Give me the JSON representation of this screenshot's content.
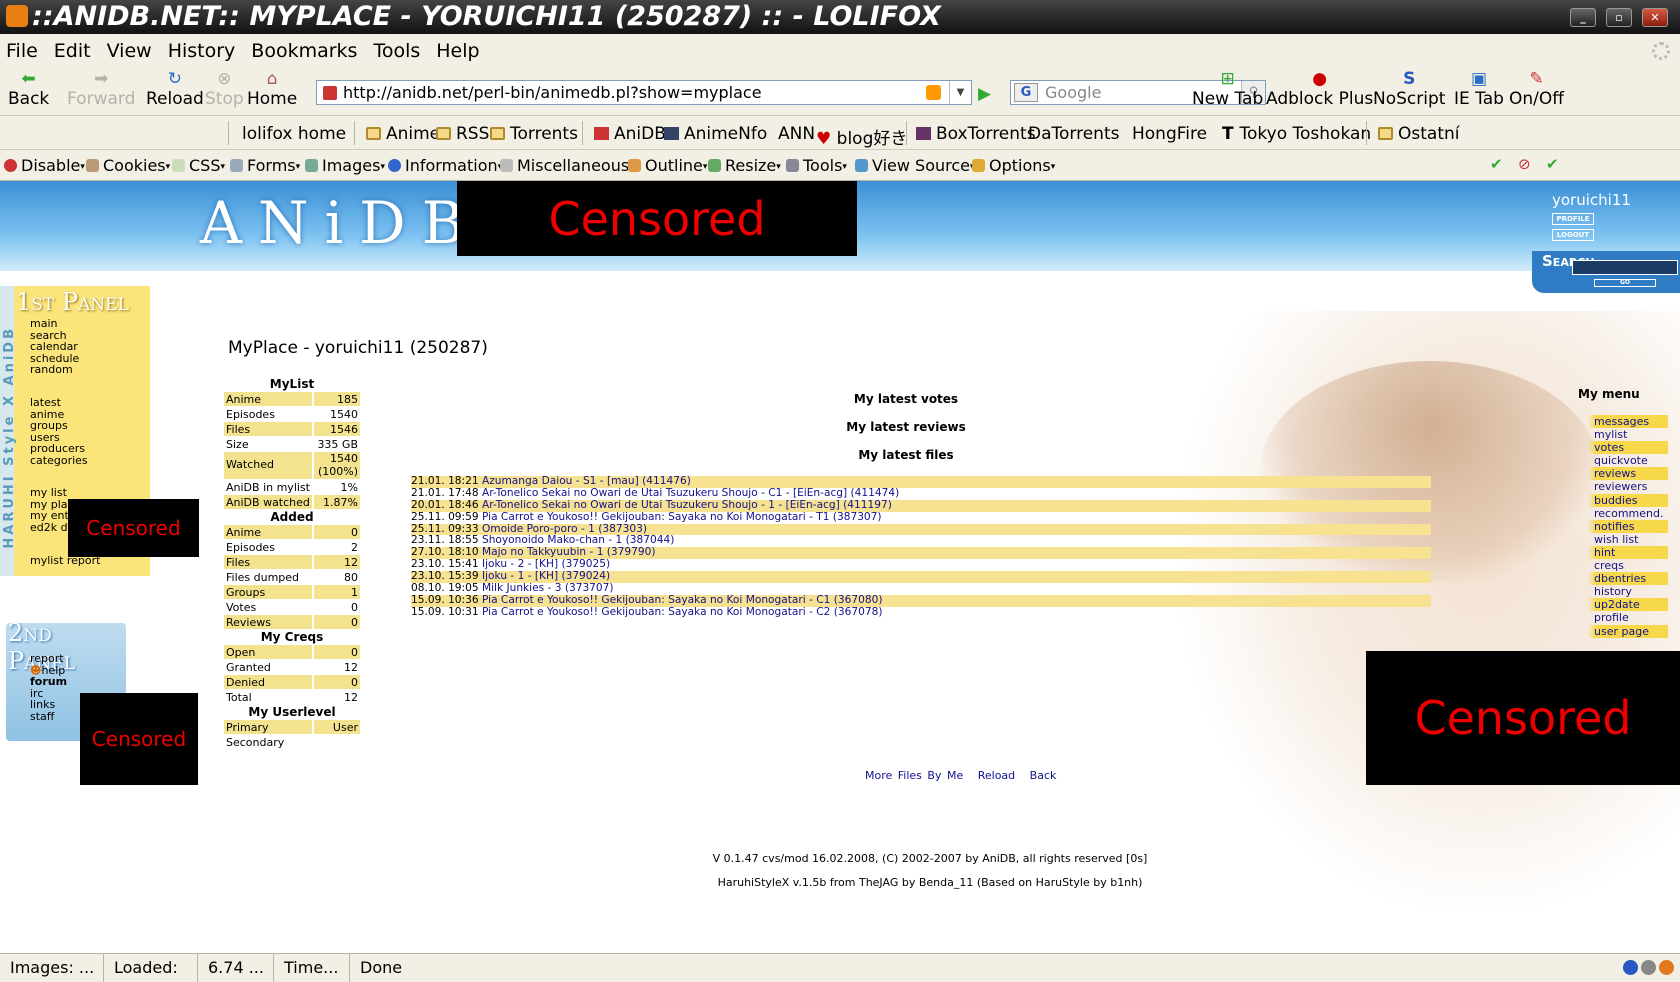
{
  "window": {
    "title": "::ANIDB.NET:: MYPLACE - YORUICHI11 (250287) :: - LOLIFOX"
  },
  "menu": [
    "File",
    "Edit",
    "View",
    "History",
    "Bookmarks",
    "Tools",
    "Help"
  ],
  "nav": {
    "back": "Back",
    "forward": "Forward",
    "reload": "Reload",
    "stop": "Stop",
    "home": "Home",
    "url": "http://anidb.net/perl-bin/animedb.pl?show=myplace",
    "search_placeholder": "Google",
    "new_tab": "New Tab",
    "adblock": "Adblock Plus",
    "noscript": "NoScript",
    "ie_tab": "IE Tab",
    "onoff": "On/Off"
  },
  "bookmarks": [
    "lolifox home",
    "Anime",
    "RSS",
    "Torrents",
    "AniDB",
    "AnimeNfo",
    "ANN",
    "blog好き",
    "BoxTorrents",
    "DaTorrents",
    "HongFire",
    "Tokyo Toshokan",
    "Ostatní"
  ],
  "webdev": [
    "Disable",
    "Cookies",
    "CSS",
    "Forms",
    "Images",
    "Information",
    "Miscellaneous",
    "Outline",
    "Resize",
    "Tools",
    "View Source",
    "Options"
  ],
  "header": {
    "logo": "ANiDB",
    "censored": "Censored",
    "username": "yoruichi11",
    "profile": "PROFILE",
    "logout": "LOGOUT",
    "search_label": "Search",
    "go": "GO"
  },
  "sidebar": {
    "panel1": "1st Panel",
    "vertical": "HARUHI Style X AniDB",
    "group1": [
      "main",
      "search",
      "calendar",
      "schedule",
      "random"
    ],
    "group2": [
      "latest",
      "anime",
      "groups",
      "users",
      "producers",
      "categories"
    ],
    "group3": [
      "my list",
      "my pla",
      "my ent",
      "ed2k d"
    ],
    "mylist_report": "mylist report",
    "panel2": "2nd Panel",
    "group4": [
      "report",
      "help",
      "forum",
      "irc",
      "links",
      "staff"
    ],
    "censored": "Censored"
  },
  "main": {
    "title": "MyPlace - yoruichi11 (250287)",
    "mylist": {
      "heading": "MyList",
      "rows": [
        {
          "k": "Anime",
          "v": "185"
        },
        {
          "k": "Episodes",
          "v": "1540"
        },
        {
          "k": "Files",
          "v": "1546"
        },
        {
          "k": "Size",
          "v": "335 GB"
        },
        {
          "k": "Watched",
          "v": "1540 (100%)"
        },
        {
          "k": "AniDB in mylist",
          "v": "1%"
        },
        {
          "k": "AniDB watched",
          "v": "1.87%"
        }
      ]
    },
    "added": {
      "heading": "Added",
      "rows": [
        {
          "k": "Anime",
          "v": "0"
        },
        {
          "k": "Episodes",
          "v": "2"
        },
        {
          "k": "Files",
          "v": "12"
        },
        {
          "k": "Files dumped",
          "v": "80"
        },
        {
          "k": "Groups",
          "v": "1"
        },
        {
          "k": "Votes",
          "v": "0"
        },
        {
          "k": "Reviews",
          "v": "0"
        }
      ]
    },
    "creqs": {
      "heading": "My Creqs",
      "rows": [
        {
          "k": "Open",
          "v": "0"
        },
        {
          "k": "Granted",
          "v": "12"
        },
        {
          "k": "Denied",
          "v": "0"
        },
        {
          "k": "Total",
          "v": "12"
        }
      ]
    },
    "userlevel": {
      "heading": "My Userlevel",
      "rows": [
        {
          "k": "Primary",
          "v": "User"
        },
        {
          "k": "Secondary",
          "v": ""
        }
      ]
    },
    "latest_votes": "My latest votes",
    "latest_reviews": "My latest reviews",
    "latest_files": "My latest files",
    "files": [
      {
        "t": "21.01. 18:21",
        "n": "Azumanga Daiou - S1 - [mau] (411476)"
      },
      {
        "t": "21.01. 17:48",
        "n": "Ar-Tonelico Sekai no Owari de Utai Tsuzukeru Shoujo - C1 - [EiEn-acg] (411474)"
      },
      {
        "t": "20.01. 18:46",
        "n": "Ar-Tonelico Sekai no Owari de Utai Tsuzukeru Shoujo - 1 - [EiEn-acg] (411197)"
      },
      {
        "t": "25.11. 09:59",
        "n": "Pia Carrot e Youkoso!! Gekijouban: Sayaka no Koi Monogatari - T1 (387307)"
      },
      {
        "t": "25.11. 09:33",
        "n": "Omoide Poro-poro - 1 (387303)"
      },
      {
        "t": "23.11. 18:55",
        "n": "Shoyonoido Mako-chan - 1 (387044)"
      },
      {
        "t": "27.10. 18:10",
        "n": "Majo no Takkyuubin - 1 (379790)"
      },
      {
        "t": "23.10. 15:41",
        "n": "Ijoku - 2 - [KH] (379025)"
      },
      {
        "t": "23.10. 15:39",
        "n": "Ijoku - 1 - [KH] (379024)"
      },
      {
        "t": "08.10. 19:05",
        "n": "Milk Junkies - 3 (373707)"
      },
      {
        "t": "15.09. 10:36",
        "n": "Pia Carrot e Youkoso!! Gekijouban: Sayaka no Koi Monogatari - C1 (367080)"
      },
      {
        "t": "15.09. 10:31",
        "n": "Pia Carrot e Youkoso!! Gekijouban: Sayaka no Koi Monogatari - C2 (367078)"
      }
    ],
    "bottom_links": [
      "More Files By Me",
      "Reload",
      "Back"
    ],
    "footer1": "V 0.1.47 cvs/mod 16.02.2008, (C) 2002-2007 by AniDB, all rights reserved [0s]",
    "footer2": "HaruhiStyleX v.1.5b from TheJAG by Benda_11 (Based on HaruStyle by b1nh)"
  },
  "mymenu": {
    "title": "My menu",
    "items": [
      "messages",
      "mylist",
      "votes",
      "quickvote",
      "reviews",
      "reviewers",
      "buddies",
      "recommend.",
      "notifies",
      "wish list",
      "hint",
      "creqs",
      "dbentries",
      "history",
      "up2date",
      "profile",
      "user page"
    ]
  },
  "censored": "Censored",
  "status": {
    "images": "Images: ...",
    "loaded": "Loaded: ...",
    "size": "6.74 ...",
    "time": "Time...",
    "done": "Done"
  }
}
